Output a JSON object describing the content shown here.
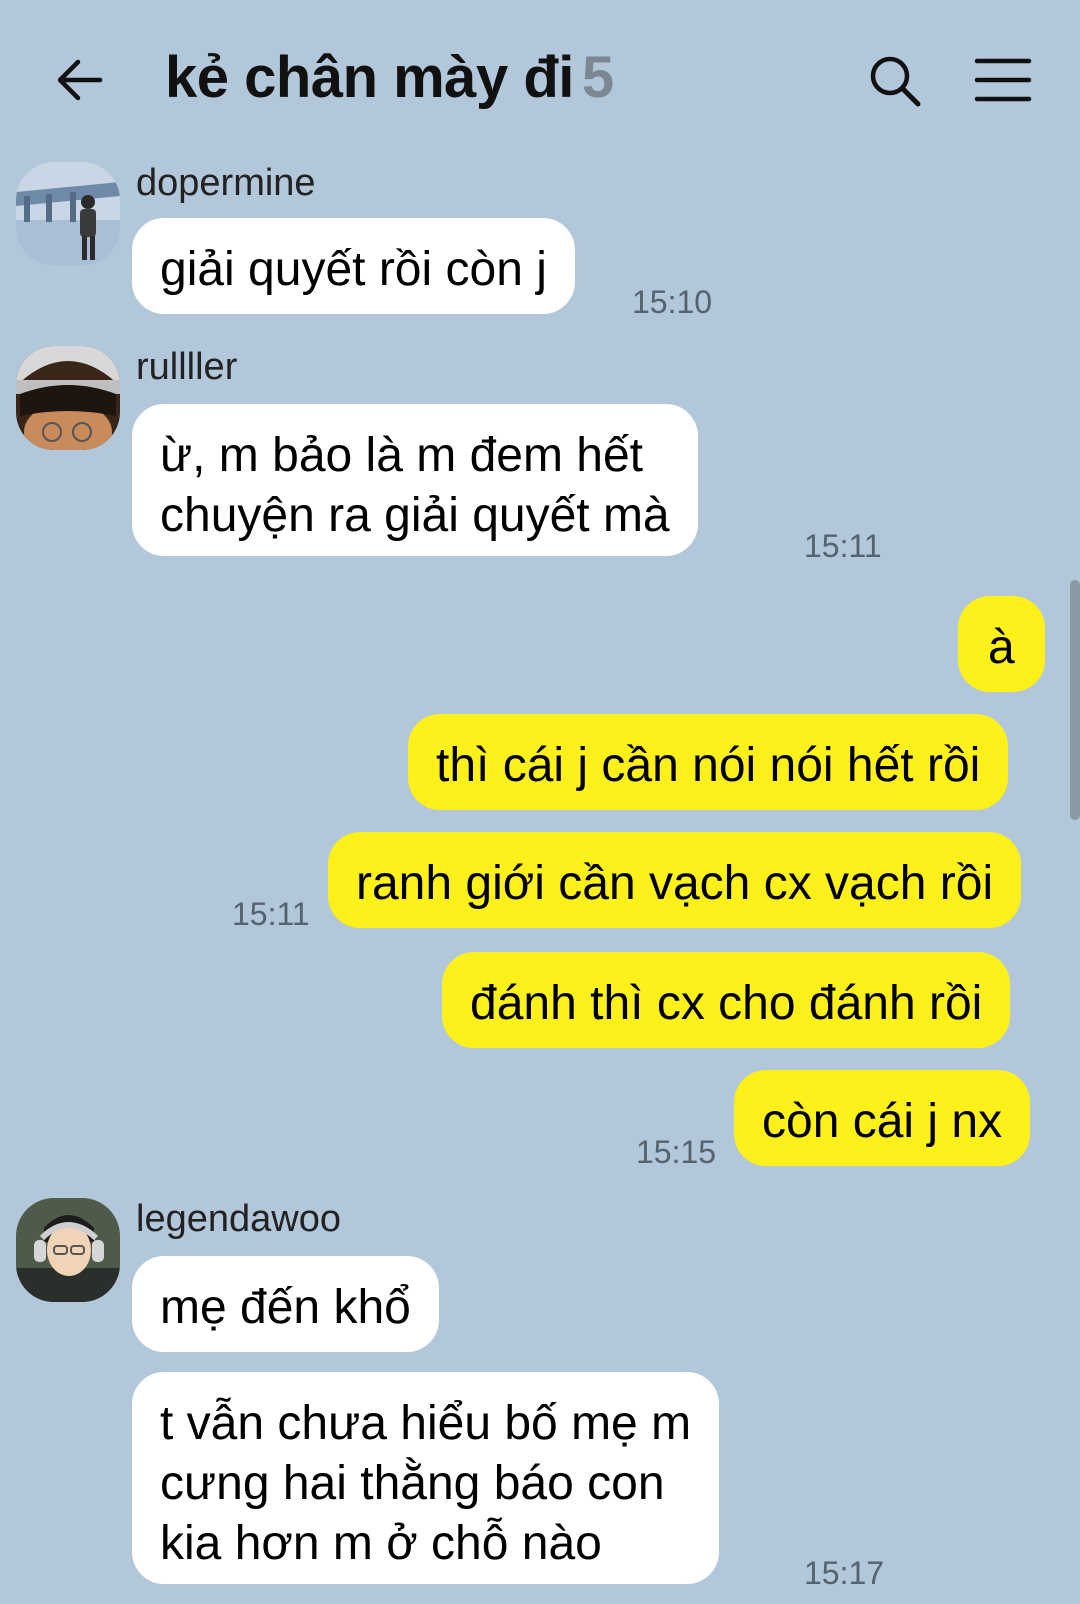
{
  "header": {
    "title": "kẻ chân mày đi",
    "member_count": "5",
    "back_icon": "arrow-left-icon",
    "search_icon": "search-icon",
    "menu_icon": "hamburger-menu-icon"
  },
  "colors": {
    "background": "#b2c7d9",
    "incoming_bubble": "#ffffff",
    "outgoing_bubble": "#fef01b",
    "count": "#7b8793"
  },
  "messages": [
    {
      "sender": "dopermine",
      "lines": [
        "giải quyết rồi còn j"
      ],
      "time": "15:10"
    },
    {
      "sender": "rullller",
      "lines": [
        "ừ, m bảo là m đem hết",
        "chuyện ra giải quyết mà"
      ],
      "time": "15:11"
    },
    {
      "lines": [
        "à"
      ]
    },
    {
      "lines": [
        "thì cái j cần nói nói hết rồi"
      ]
    },
    {
      "lines": [
        "ranh giới cần vạch cx vạch rồi"
      ],
      "time": "15:11"
    },
    {
      "lines": [
        "đánh thì cx cho đánh rồi"
      ]
    },
    {
      "lines": [
        "còn cái j nx"
      ],
      "time": "15:15"
    },
    {
      "sender": "legendawoo",
      "lines": [
        "mẹ đến khổ"
      ]
    },
    {
      "lines": [
        "t vẫn chưa hiểu bố mẹ m",
        "cưng hai thằng báo con",
        "kia hơn m ở chỗ nào"
      ],
      "time": "15:17"
    }
  ]
}
